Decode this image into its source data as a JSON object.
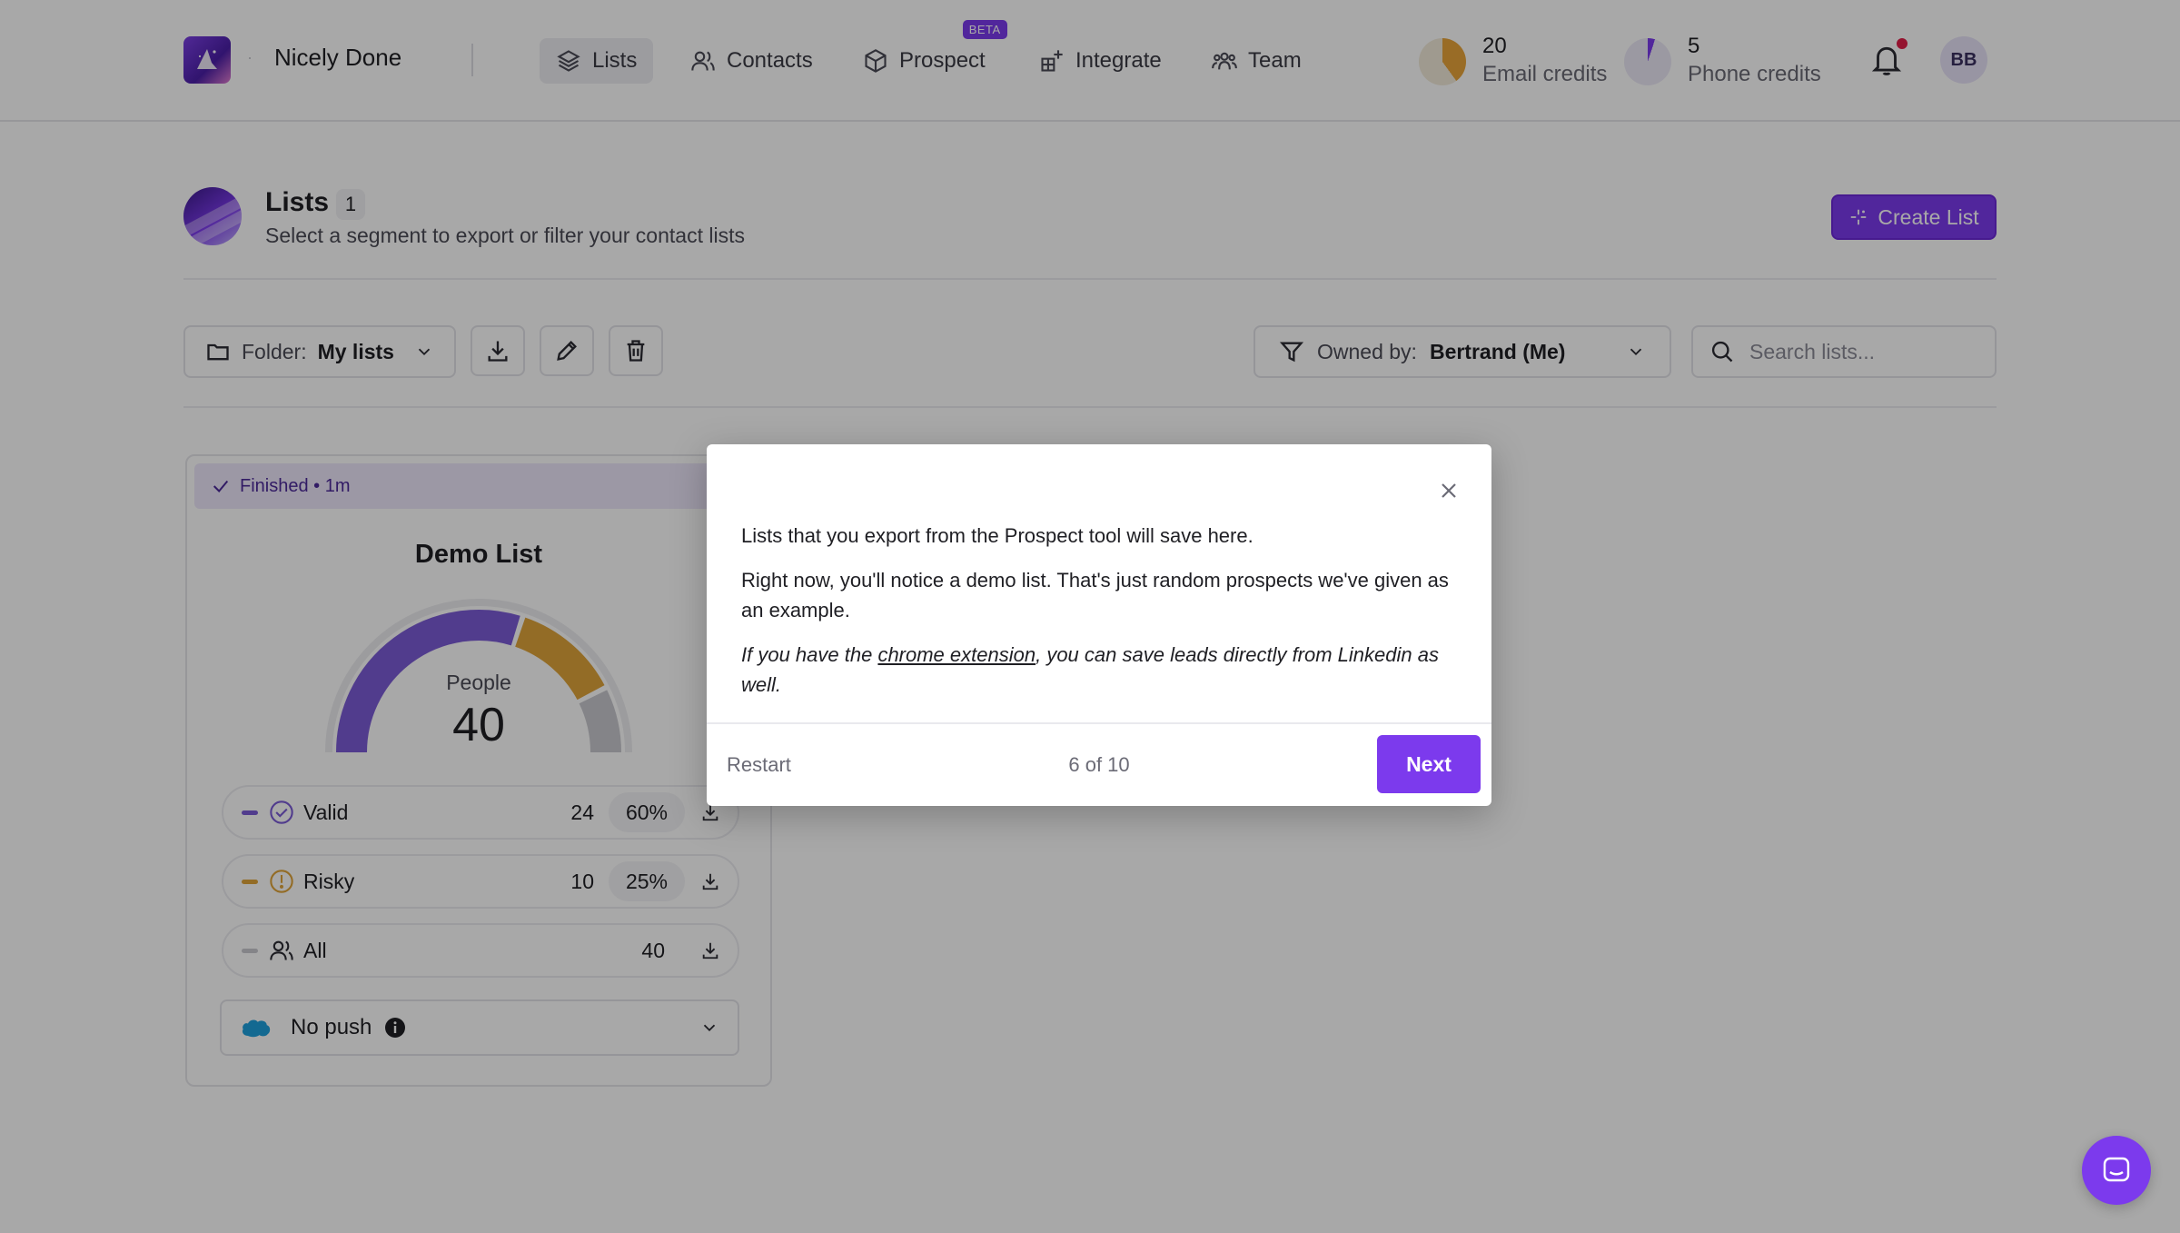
{
  "workspace": {
    "name": "Nicely Done"
  },
  "nav": {
    "items": [
      {
        "label": "Lists",
        "icon": "layers-icon",
        "active": true
      },
      {
        "label": "Contacts",
        "icon": "users-icon"
      },
      {
        "label": "Prospect",
        "icon": "cube-icon",
        "badge": "BETA"
      },
      {
        "label": "Integrate",
        "icon": "grid-plus-icon"
      },
      {
        "label": "Team",
        "icon": "team-icon"
      }
    ]
  },
  "credits": {
    "email": {
      "value": "20",
      "label": "Email credits",
      "fraction": 0.4,
      "color": "#e8a53a"
    },
    "phone": {
      "value": "5",
      "label": "Phone credits",
      "fraction": 0.05,
      "color": "#7c3aed"
    }
  },
  "notifications": {
    "has_unread": true
  },
  "user": {
    "initials": "BB"
  },
  "header": {
    "title": "Lists",
    "count": "1",
    "subtitle": "Select a segment to export or filter your contact lists",
    "create_label": "Create List"
  },
  "toolbar": {
    "folder_label": "Folder:",
    "folder_value": "My lists",
    "owner_label": "Owned by:",
    "owner_value": "Bertrand (Me)",
    "search_placeholder": "Search lists..."
  },
  "card": {
    "status": "Finished • 1m",
    "title": "Demo List",
    "gauge_label": "People",
    "gauge_value": "40",
    "segments": [
      {
        "name": "Valid",
        "count": "24",
        "percent": "60%",
        "color": "#7c5cd6",
        "icon": "check-circle-icon"
      },
      {
        "name": "Risky",
        "count": "10",
        "percent": "25%",
        "color": "#e0a43a",
        "icon": "warning-circle-icon"
      },
      {
        "name": "All",
        "count": "40",
        "percent": "",
        "color": "#c9c9cf",
        "icon": "users-icon"
      }
    ],
    "push_label": "No push"
  },
  "colors": {
    "accent": "#7c3aed",
    "valid": "#7c5cd6",
    "risky": "#e0a43a",
    "rest": "#c9c9cf"
  },
  "modal": {
    "paragraph1": "Lists that you export from the Prospect tool will save here.",
    "paragraph2": "Right now, you'll notice a demo list. That's just random prospects we've given as an example.",
    "paragraph3_prefix": "If you have the ",
    "paragraph3_link": "chrome extension",
    "paragraph3_suffix": ", you can save leads directly from Linkedin as well.",
    "restart_label": "Restart",
    "step_label": "6 of 10",
    "next_label": "Next"
  }
}
